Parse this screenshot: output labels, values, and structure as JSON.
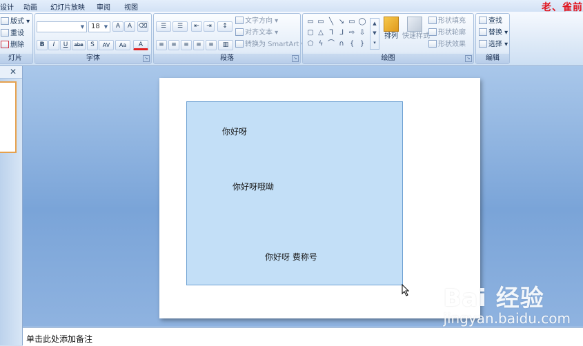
{
  "menu": {
    "tabs": [
      "设计",
      "动画",
      "幻灯片放映",
      "审阅",
      "视图"
    ],
    "overlay_title": "老、雀前"
  },
  "ribbon": {
    "slides_group": {
      "label": "灯片",
      "layout": "版式",
      "reset": "重设",
      "delete": "删除"
    },
    "font_group": {
      "label": "字体",
      "font_name": "",
      "font_size": "18",
      "grow": "A",
      "shrink": "A",
      "bold": "B",
      "italic": "I",
      "underline": "U",
      "strike": "abe",
      "shadow": "S",
      "spacing": "AV",
      "case": "Aa",
      "color": "A"
    },
    "paragraph_group": {
      "label": "段落",
      "text_direction": "文字方向",
      "align_text": "对齐文本",
      "smartart": "转换为 SmartArt"
    },
    "drawing_group": {
      "label": "绘图",
      "arrange": "排列",
      "quick_styles": "快速样式",
      "shape_fill": "形状填充",
      "shape_outline": "形状轮廓",
      "shape_effects": "形状效果"
    },
    "editing_group": {
      "label": "编辑",
      "find": "查找",
      "replace": "替换",
      "select": "选择"
    }
  },
  "panel": {
    "close": "✕"
  },
  "slide": {
    "shape_fill": "#c3dff7",
    "line1": "你好呀",
    "line2": "你好呀哦呦",
    "line3": "你好呀 费称号"
  },
  "notes": {
    "placeholder": "单击此处添加备注"
  },
  "watermark": {
    "logo": "Bai 经验",
    "url": "jingyan.baidu.com"
  }
}
